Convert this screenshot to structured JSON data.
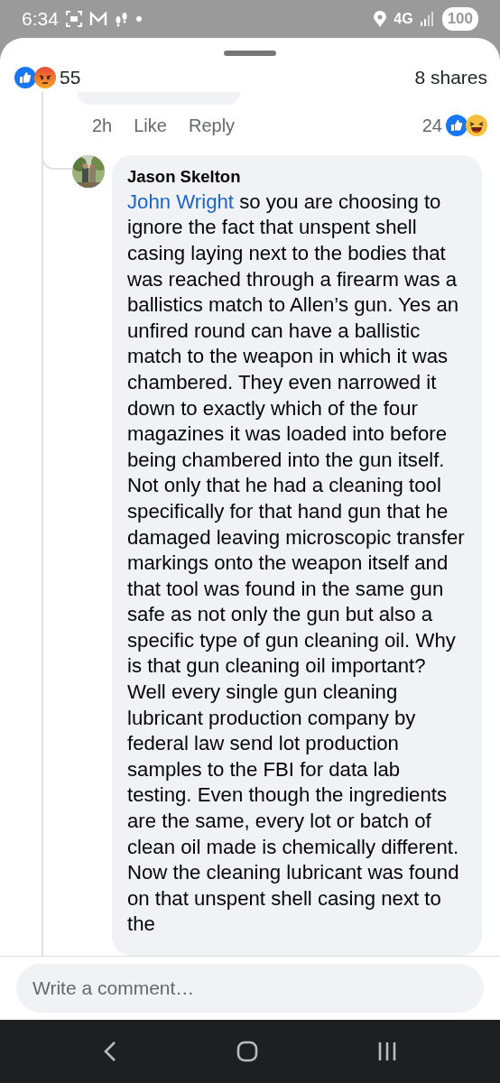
{
  "status_bar": {
    "time": "6:34",
    "battery": "100",
    "network": "4G"
  },
  "reactions": {
    "count": "55",
    "shares": "8 shares"
  },
  "previous_comment": {
    "time": "2h",
    "like": "Like",
    "reply": "Reply",
    "reaction_count": "24"
  },
  "reply": {
    "author": "Jason Skelton",
    "mention": "John Wright",
    "text": " so you are choosing to ignore the fact that unspent shell casing laying next to the bodies that was reached through a firearm was a ballistics match to Allen’s gun. Yes an unfired round can have a ballistic match to the weapon in which it was chambered. They even narrowed it down to exactly which of the four magazines it was loaded into before being chambered into the gun itself. Not only that he had a cleaning tool specifically for that hand gun that he damaged leaving microscopic transfer markings onto the weapon itself and that tool was found in the same gun safe as not only the gun but also a specific type of gun cleaning oil. Why is that gun cleaning oil important? Well every single gun cleaning lubricant production company by federal law send lot production samples to the FBI for data lab testing. Even though the ingredients are the same, every lot or batch of clean oil made is chemically different. Now the cleaning lubricant was found on that unspent shell casing next to the"
  },
  "composer": {
    "placeholder": "Write a comment…"
  }
}
